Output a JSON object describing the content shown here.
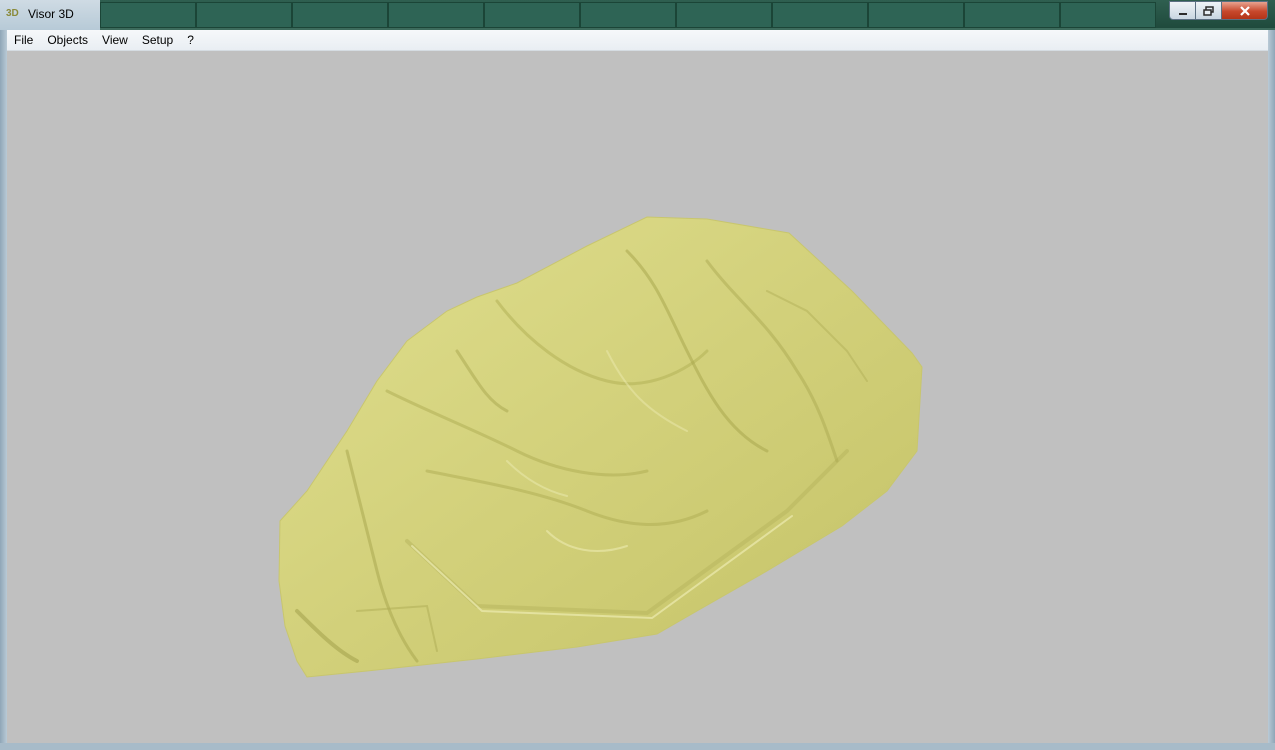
{
  "window": {
    "title": "Visor 3D",
    "icon": "3d-app-icon",
    "controls": [
      "minimize",
      "maximize",
      "close"
    ]
  },
  "menu": {
    "items": [
      "File",
      "Objects",
      "View",
      "Setup",
      "?"
    ]
  },
  "viewport": {
    "background": "#c0c0c0",
    "model_color": "#d4d27a",
    "content": "3d-terrain-model"
  }
}
